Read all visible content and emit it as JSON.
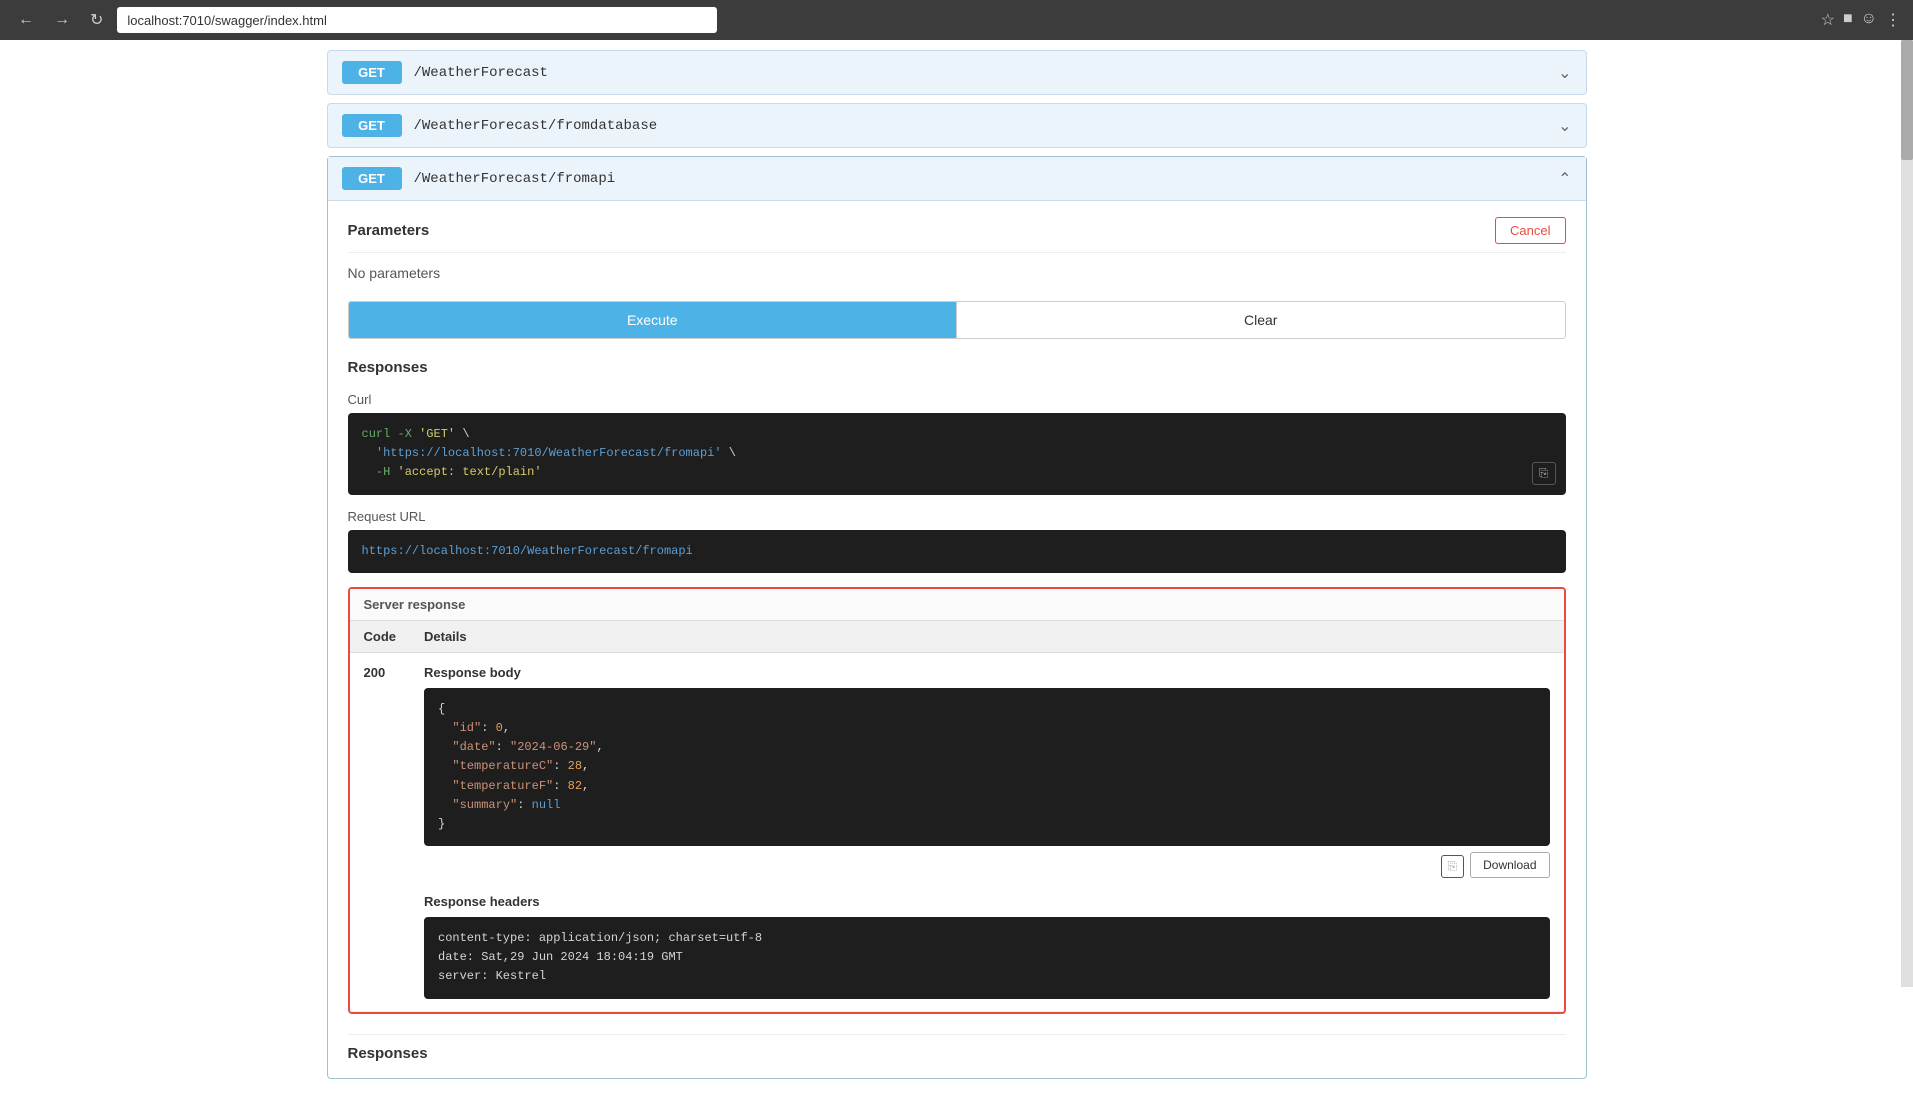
{
  "browser": {
    "url": "localhost:7010/swagger/index.html"
  },
  "endpoints": [
    {
      "method": "GET",
      "path": "/WeatherForecast",
      "expanded": false
    },
    {
      "method": "GET",
      "path": "/WeatherForecast/fromdatabase",
      "expanded": false
    },
    {
      "method": "GET",
      "path": "/WeatherForecast/fromapi",
      "expanded": true
    }
  ],
  "expanded_endpoint": {
    "method": "GET",
    "path": "/WeatherForecast/fromapi",
    "parameters_title": "Parameters",
    "cancel_label": "Cancel",
    "no_params_text": "No parameters",
    "execute_label": "Execute",
    "clear_label": "Clear",
    "responses_title": "Responses",
    "curl_label": "Curl",
    "curl_code_line1": "curl -X 'GET' \\",
    "curl_code_line2": "  'https://localhost:7010/WeatherForecast/fromapi' \\",
    "curl_code_line3": "  -H 'accept: text/plain'",
    "request_url_label": "Request URL",
    "request_url_value": "https://localhost:7010/WeatherForecast/fromapi",
    "server_response_label": "Server response",
    "code_col": "Code",
    "details_col": "Details",
    "response_code": "200",
    "response_body_label": "Response body",
    "response_body_json": {
      "line1": "{",
      "line2": "  \"id\": 0,",
      "line3": "  \"date\": \"2024-06-29\",",
      "line4": "  \"temperatureC\": 28,",
      "line5": "  \"temperatureF\": 82,",
      "line6": "  \"summary\": null",
      "line7": "}"
    },
    "download_label": "Download",
    "response_headers_label": "Response headers",
    "response_headers": {
      "line1": "content-type: application/json; charset=utf-8",
      "line2": "date: Sat,29 Jun 2024 18:04:19 GMT",
      "line3": "server: Kestrel"
    },
    "bottom_responses_title": "Responses"
  }
}
